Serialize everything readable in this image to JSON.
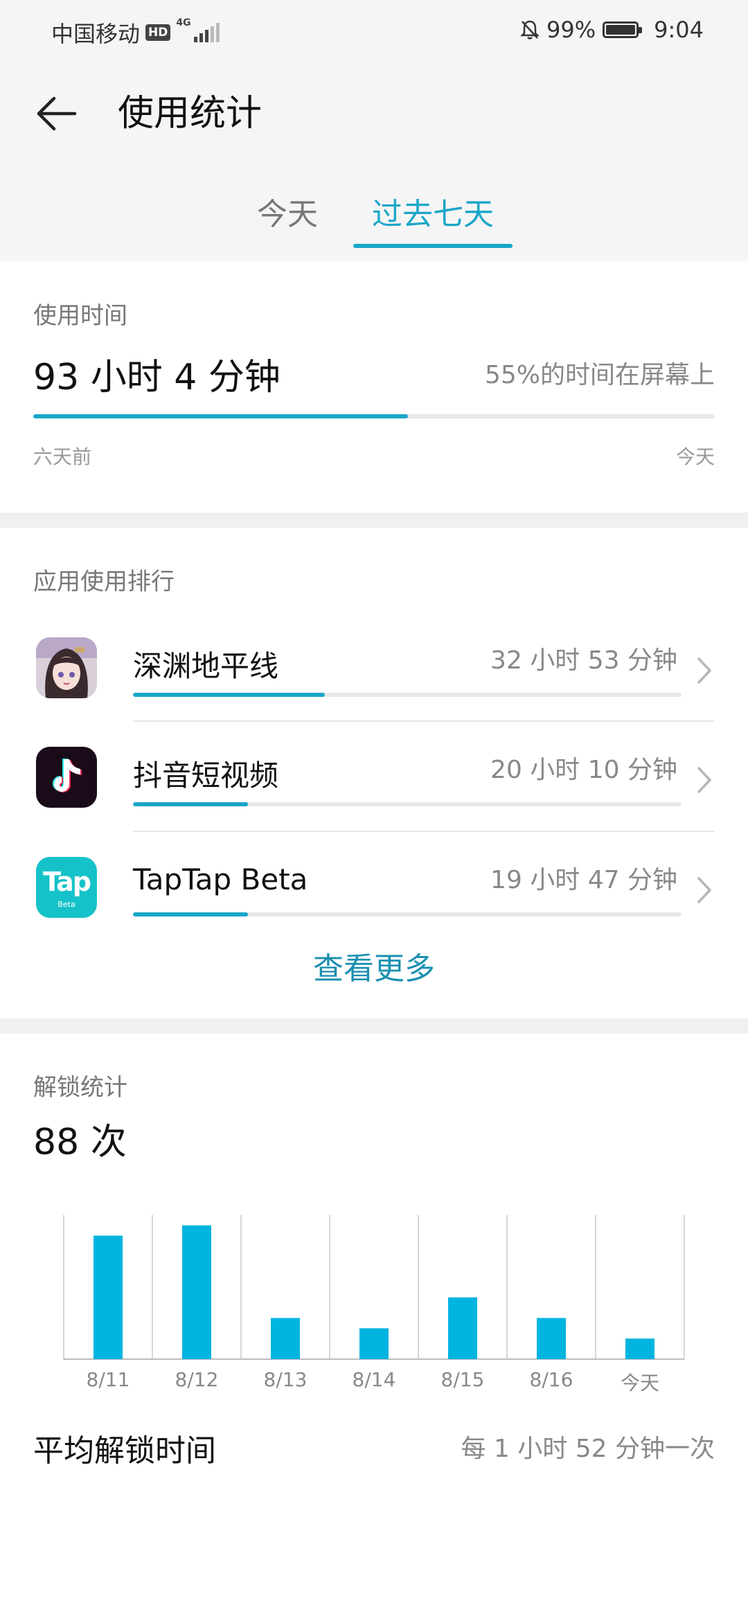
{
  "status_bar": {
    "carrier": "中国移动",
    "hd_badge": "HD",
    "network": "4G",
    "battery_text": "99%",
    "battery_level": 0.99,
    "time": "9:04"
  },
  "header": {
    "title": "使用统计",
    "back_icon": "back-arrow-icon"
  },
  "tabs": [
    {
      "label": "今天",
      "selected": false
    },
    {
      "label": "过去七天",
      "selected": true
    }
  ],
  "accent_color": "#1aa6c9",
  "usage": {
    "label": "使用时间",
    "total": "93 小时 4 分钟",
    "screen_ratio_text": "55%的时间在屏幕上",
    "screen_ratio": 0.55,
    "range_start": "六天前",
    "range_end": "今天"
  },
  "ranking": {
    "title": "应用使用排行",
    "apps": [
      {
        "name": "深渊地平线",
        "time": "32 小时 53 分钟",
        "share": 0.35,
        "icon": "anime-girl-app-icon"
      },
      {
        "name": "抖音短视频",
        "time": "20 小时 10 分钟",
        "share": 0.21,
        "icon": "tiktok-icon"
      },
      {
        "name": "TapTap Beta",
        "time": "19 小时 47 分钟",
        "share": 0.21,
        "icon": "taptap-icon",
        "icon_text": "Tap",
        "icon_subtext": "Beta"
      }
    ],
    "see_more": "查看更多"
  },
  "unlock": {
    "label": "解锁统计",
    "count": "88 次",
    "avg_label": "平均解锁时间",
    "avg_value": "每 1 小时 52 分钟一次"
  },
  "chart_data": {
    "type": "bar",
    "categories": [
      "8/11",
      "8/12",
      "8/13",
      "8/14",
      "8/15",
      "8/16",
      "今天"
    ],
    "values": [
      24,
      26,
      8,
      6,
      12,
      8,
      4
    ],
    "title": "",
    "xlabel": "",
    "ylabel": "",
    "ylim": [
      0,
      28
    ],
    "grid": "vertical",
    "color": "#00b4e0"
  }
}
